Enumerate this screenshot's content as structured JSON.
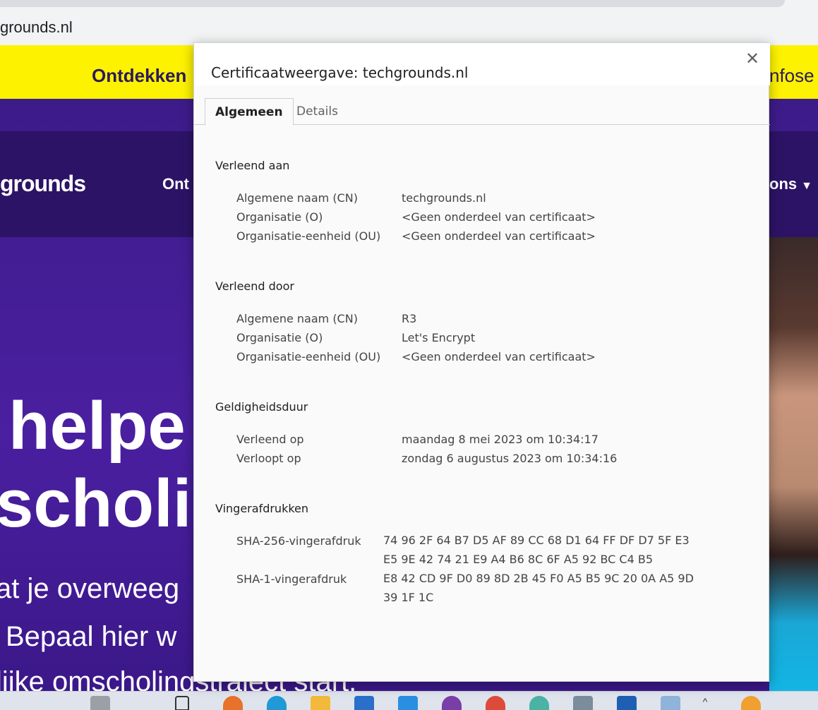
{
  "browser": {
    "url": "grounds.nl"
  },
  "site": {
    "banner_left": "Ontdekken",
    "banner_right": "nfose",
    "logo": "grounds",
    "nav_left": "Ont",
    "nav_right": "ons",
    "hero_line1": "helpe",
    "hero_line2": "scholi",
    "hero_p1": "at je overweeg",
    "hero_p2": "Bepaal hier w",
    "hero_p3": "lijke omscholingstraject start."
  },
  "dialog": {
    "title": "Certificaatweergave: techgrounds.nl",
    "close_glyph": "✕",
    "tabs": [
      {
        "label": "Algemeen"
      },
      {
        "label": "Details"
      }
    ],
    "issued_to": {
      "title": "Verleend aan",
      "rows": [
        {
          "label": "Algemene naam (CN)",
          "value": "techgrounds.nl"
        },
        {
          "label": "Organisatie (O)",
          "value": "<Geen onderdeel van certificaat>"
        },
        {
          "label": "Organisatie-eenheid (OU)",
          "value": "<Geen onderdeel van certificaat>"
        }
      ]
    },
    "issued_by": {
      "title": "Verleend door",
      "rows": [
        {
          "label": "Algemene naam (CN)",
          "value": "R3"
        },
        {
          "label": "Organisatie (O)",
          "value": "Let's Encrypt"
        },
        {
          "label": "Organisatie-eenheid (OU)",
          "value": "<Geen onderdeel van certificaat>"
        }
      ]
    },
    "validity": {
      "title": "Geldigheidsduur",
      "rows": [
        {
          "label": "Verleend op",
          "value": "maandag 8 mei 2023 om 10:34:17"
        },
        {
          "label": "Verloopt op",
          "value": "zondag 6 augustus 2023 om 10:34:16"
        }
      ]
    },
    "fingerprints": {
      "title": "Vingerafdrukken",
      "rows": [
        {
          "label": "SHA-256-vingerafdruk",
          "value": "74 96 2F 64 B7 D5 AF 89 CC 68 D1 64 FF DF D7 5F E3 E5 9E 42 74 21 E9 A4 B6 8C 6F A5 92 BC C4 B5"
        },
        {
          "label": "SHA-1-vingerafdruk",
          "value": "E8 42 CD 9F D0 89 8D 2B 45 F0 A5 B5 9C 20 0A A5 9D 39 1F 1C"
        }
      ]
    }
  },
  "colors": {
    "banner_yellow": "#fdf200",
    "site_purple": "#3d1a86",
    "dialog_bg": "#fafafa"
  }
}
